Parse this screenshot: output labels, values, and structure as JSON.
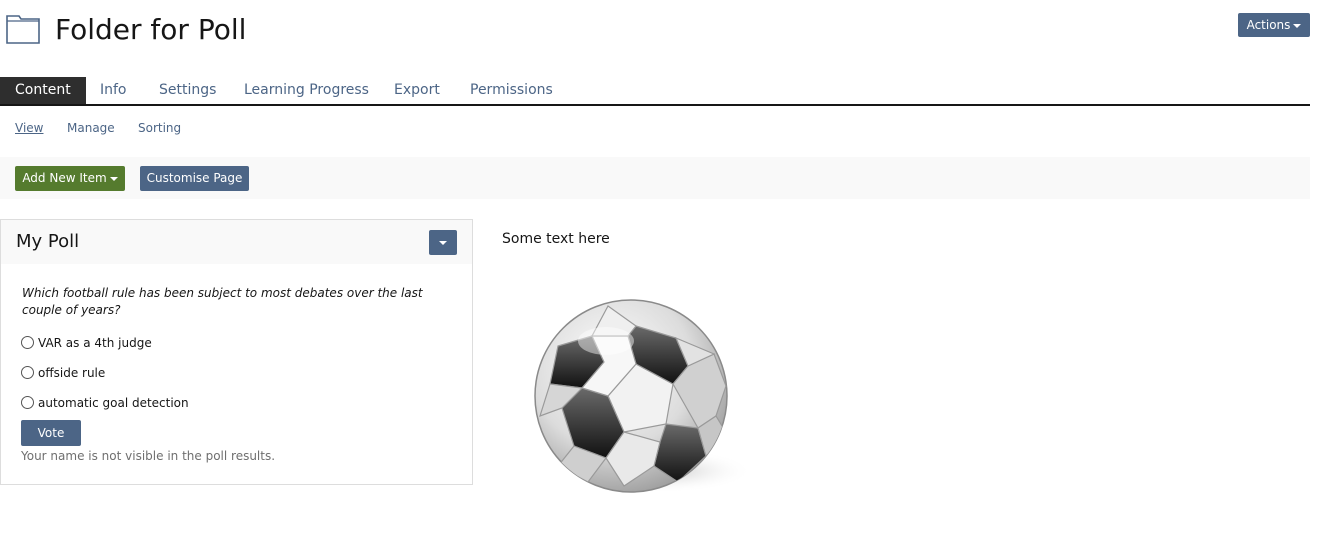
{
  "header": {
    "title": "Folder for Poll",
    "actions_label": "Actions",
    "folder_icon": "folder-icon"
  },
  "tabs": [
    {
      "label": "Content",
      "active": true
    },
    {
      "label": "Info",
      "active": false
    },
    {
      "label": "Settings",
      "active": false
    },
    {
      "label": "Learning Progress",
      "active": false
    },
    {
      "label": "Export",
      "active": false
    },
    {
      "label": "Permissions",
      "active": false
    }
  ],
  "subtabs": [
    {
      "label": "View",
      "active": true
    },
    {
      "label": "Manage",
      "active": false
    },
    {
      "label": "Sorting",
      "active": false
    }
  ],
  "toolbar": {
    "add_new_label": "Add New Item",
    "customise_label": "Customise Page"
  },
  "poll": {
    "title": "My Poll",
    "question": "Which football rule has been subject to most debates over the last couple of years?",
    "options": [
      {
        "label": "VAR as a 4th judge",
        "selected": false
      },
      {
        "label": "offside rule",
        "selected": false
      },
      {
        "label": "automatic goal detection",
        "selected": false
      }
    ],
    "vote_label": "Vote",
    "note": "Your name is not visible in the poll results."
  },
  "content": {
    "text": "Some text here",
    "image_icon": "soccer-ball-image"
  },
  "colors": {
    "primary": "#4c6586",
    "success": "#557b2e",
    "active_tab": "#2e2e2e",
    "toolbar_bg": "#f9f9f9"
  }
}
